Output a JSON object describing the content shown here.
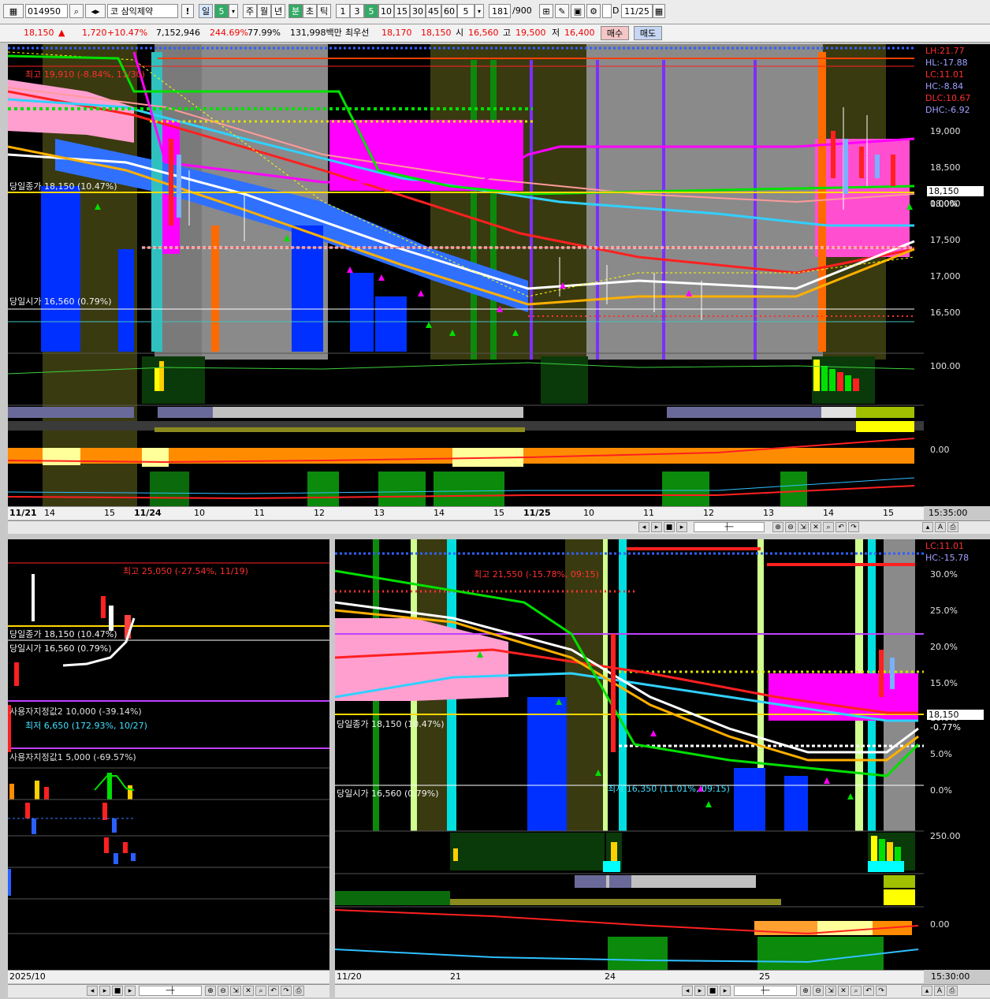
{
  "toolbar": {
    "code": "014950",
    "name": "코 삼익제약",
    "alert": "!",
    "period_il": "일",
    "period_il_n": "5",
    "periods": [
      "주",
      "월",
      "년",
      "분",
      "초",
      "틱"
    ],
    "intervals": [
      "1",
      "3",
      "5",
      "10",
      "15",
      "30",
      "45",
      "60"
    ],
    "interval_sel": "5",
    "count": "181",
    "count_total": "/900",
    "date_check": "D",
    "date": "11/25"
  },
  "quote": {
    "price": "18,150",
    "arrow": "▲",
    "change": "1,720",
    "change_pct": "+10.47%",
    "volume": "7,152,946",
    "vol_ratio": "244.69%",
    "turnover": "77.99%",
    "amount": "131,998백만",
    "best_label": "최우선",
    "ask": "18,170",
    "bid": "18,150",
    "open_label": "시",
    "open": "16,560",
    "high_label": "고",
    "high": "19,500",
    "low_label": "저",
    "low": "16,400",
    "buy": "매수",
    "sell": "매도"
  },
  "top_chart": {
    "info": [
      "LH:21.77",
      "HL:-17.88",
      "LC:11.01",
      "HC:-8.84",
      "DLC:10.67",
      "DHC:-6.92"
    ],
    "info_colors": [
      "#ff3030",
      "#a0a0ff",
      "#ff3030",
      "#a0a0ff",
      "#ff3030",
      "#a0a0ff"
    ],
    "price_ticks": [
      "19,000",
      "18,500",
      "18,000",
      "17,500",
      "17,000",
      "16,500"
    ],
    "current_price": "18,150",
    "current_pct": "0.00%",
    "ind_ticks": [
      "100.00",
      "0.00"
    ],
    "high_note": "최고 19,910 (-8.84%, 11/30)",
    "close_label": "당일종가 18,150 (10.47%)",
    "open_label": "당일시가 16,560 (0.79%)",
    "time_ticks": [
      "11/21",
      "14",
      "15",
      "11/24",
      "10",
      "11",
      "12",
      "13",
      "14",
      "15",
      "11/25",
      "10",
      "11",
      "12",
      "13",
      "14",
      "15"
    ],
    "clock": "15:35:00"
  },
  "bottom_left": {
    "high_note": "최고 25,050 (-27.54%, 11/19)",
    "close_label": "당일종가 18,150 (10.47%)",
    "open_label": "당일시가 16,560 (0.79%)",
    "user2": "사용자지정값2 10,000 (-39.14%)",
    "low_note": "최저 6,650 (172.93%, 10/27)",
    "user1": "사용자지정값1 5,000 (-69.57%)",
    "time_label": "2025/10"
  },
  "bottom_right": {
    "info": [
      "LC:11.01",
      "HC:-15.78"
    ],
    "pct_ticks": [
      "30.0%",
      "25.0%",
      "20.0%",
      "15.0%",
      "10.0%",
      "5.0%",
      "0.0%"
    ],
    "current_price": "18,150",
    "current_pct": "-0.77%",
    "ind_ticks": [
      "250.00",
      "0.00"
    ],
    "high_note": "최고 21,550 (-15.78%, 09:15)",
    "close_label": "당일종가 18,150 (10.47%)",
    "open_label": "당일시가 16,560 (0.79%)",
    "low_note": "최저 16,350 (11.01%, 09:15)",
    "time_ticks": [
      "11/20",
      "21",
      "24",
      "25"
    ],
    "clock": "15:30:00"
  },
  "colors": {
    "up": "#ff2020",
    "down": "#2a60ff",
    "magenta": "#ff00ff",
    "cyan": "#00ffff",
    "lime": "#00ff00",
    "yellow": "#ffff00",
    "orange": "#ff8c00"
  }
}
